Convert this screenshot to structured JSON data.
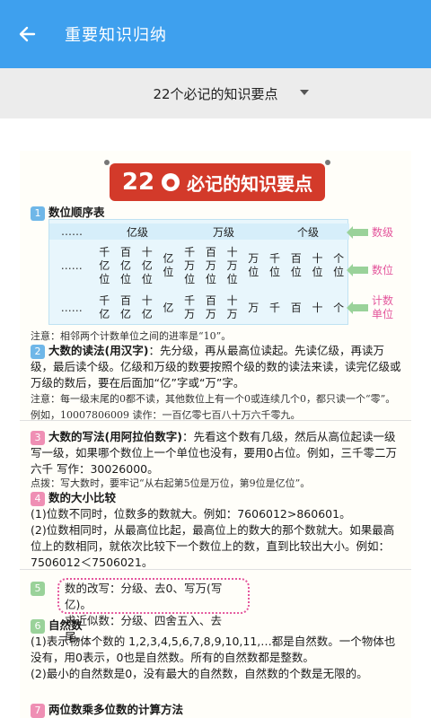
{
  "appbar": {
    "title": "重要知识归纳",
    "back_icon": "arrow-left-icon",
    "bg": "#3ea0ee"
  },
  "selector": {
    "value": "22个必记的知识要点"
  },
  "page": {
    "banner": {
      "num": "22",
      "circle": "●",
      "text": "必记的知识要点"
    },
    "s1": {
      "badge": "1",
      "title": "数位顺序表",
      "row1": {
        "dots": "……",
        "levels": [
          "亿级",
          "万级",
          "个级"
        ]
      },
      "row2": {
        "dots": "……",
        "cols": [
          "千\n亿\n位",
          "百\n亿\n位",
          "十\n亿\n位",
          "亿\n位",
          "千\n万\n位",
          "百\n万\n位",
          "十\n万\n位",
          "万\n位",
          "千\n位",
          "百\n位",
          "十\n位",
          "个\n位"
        ]
      },
      "row3": {
        "dots": "……",
        "cols": [
          "千\n亿",
          "百\n亿",
          "十\n亿",
          "亿",
          "千\n万",
          "百\n万",
          "十\n万",
          "万",
          "千",
          "百",
          "十",
          "个"
        ]
      },
      "labels": [
        "数级",
        "数位",
        "计数\n单位"
      ],
      "note": "注意：相邻两个计数单位之间的进率是“10”。"
    },
    "s2": {
      "badge": "2",
      "title": "大数的读法(用汉字)",
      "text": "：先分级，再从最高位读起。先读亿级，再读万级，最后读个级。亿级和万级的数要按照个级的数的读法来读，读完亿级或万级的数后，要在后面加“亿”字或“万”字。",
      "note": "注意：每一级末尾的0都不读，其他数位上有一个0或连续几个0，都只读一个“零”。例如，10007806009 读作：一百亿零七百八十万六千零九。"
    },
    "s3": {
      "badge": "3",
      "title": "大数的写法(用阿拉伯数字)",
      "text": "：先看这个数有几级，然后从高位起读一级写一级，如果哪个数位上一个单位也没有，要用0占位。例如，三千零二万六千 写作：30026000。",
      "note": "点拨：写大数时，要牢记“从右起第5位是万位，第9位是亿位”。"
    },
    "s4": {
      "badge": "4",
      "title": "数的大小比较",
      "lines": [
        "(1)位数不同时，位数多的数就大。例如：7606012>860601。",
        "(2)位数相同时，从最高位比起，最高位上的数大的那个数就大。如果最高位上的数相同，就依次比较下一个数位上的数，直到比较出大小。例如：7506012＜7506021。"
      ]
    },
    "s5": {
      "badge": "5",
      "lines": [
        "数的改写：分级、去0、写万(写亿)。",
        "求近似数：分级、四舍五入、去尾。"
      ]
    },
    "s6": {
      "badge": "6",
      "title": "自然数",
      "lines": [
        "(1)表示物体个数的 1,2,3,4,5,6,7,8,9,10,11,…都是自然数。一个物体也没有，用0表示，0也是自然数。所有的自然数都是整数。",
        "(2)最小的自然数是0，没有最大的自然数，自然数的个数是无限的。"
      ]
    },
    "s7": {
      "badge": "7",
      "title": "两位数乘多位数的计算方法"
    }
  }
}
